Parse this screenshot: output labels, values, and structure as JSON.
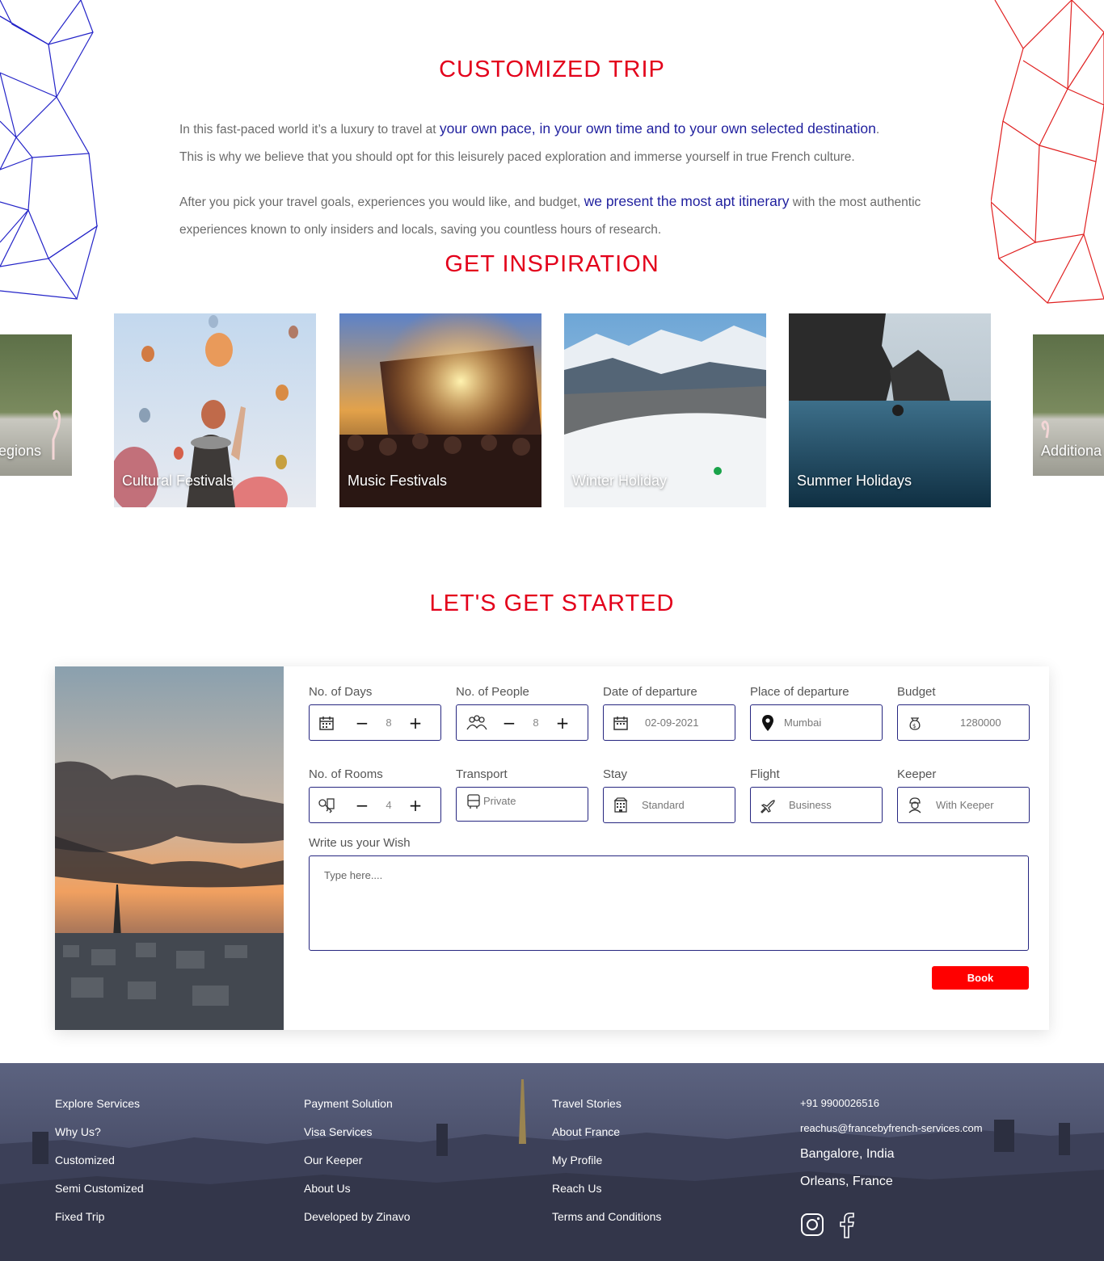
{
  "customized_trip": {
    "title": "CUSTOMIZED TRIP",
    "p1_a": "In this fast-paced world it’s a luxury to travel at ",
    "p1_hl": "your own pace, in your own time and to your own selected destination",
    "p1_b": ".",
    "p1_c": "This is why we believe that you should opt for this leisurely paced exploration and immerse yourself in true French culture.",
    "p2_a": "After you pick your travel goals, experiences you would like, and budget, ",
    "p2_hl": "we present the most apt itinerary",
    "p2_b": " with the most authentic experiences known to only insiders and locals, saving you countless hours of research."
  },
  "inspiration": {
    "title": "GET INSPIRATION",
    "cards": [
      {
        "label": "egions"
      },
      {
        "label": "Cultural Festivals"
      },
      {
        "label": "Music Festivals"
      },
      {
        "label": "Winter Holiday"
      },
      {
        "label": "Summer Holidays"
      },
      {
        "label": "Additiona"
      }
    ]
  },
  "get_started": {
    "title": "LET'S GET STARTED",
    "fields": {
      "days": {
        "label": "No. of Days",
        "value": "8",
        "icon": "calendar-icon"
      },
      "people": {
        "label": "No. of People",
        "value": "8",
        "icon": "people-icon"
      },
      "date": {
        "label": "Date of departure",
        "value": "02-09-2021",
        "icon": "calendar-icon"
      },
      "place": {
        "label": "Place of departure",
        "placeholder": "Mumbai",
        "icon": "location-pin-icon"
      },
      "budget": {
        "label": "Budget",
        "value": "1280000",
        "icon": "money-bag-icon"
      },
      "rooms": {
        "label": "No. of Rooms",
        "value": "4",
        "icon": "room-key-icon"
      },
      "transport": {
        "label": "Transport",
        "value": "Private",
        "icon": "bus-icon"
      },
      "stay": {
        "label": "Stay",
        "value": "Standard",
        "icon": "building-icon"
      },
      "flight": {
        "label": "Flight",
        "value": "Business",
        "icon": "plane-icon"
      },
      "keeper": {
        "label": "Keeper",
        "value": "With Keeper",
        "icon": "keeper-icon"
      }
    },
    "wish_label": "Write us your Wish",
    "wish_placeholder": "Type here....",
    "book_label": "Book",
    "minus": "−",
    "plus": "+"
  },
  "footer": {
    "col1": [
      "Explore Services",
      "Why Us?",
      "Customized",
      "Semi Customized",
      "Fixed Trip"
    ],
    "col2": [
      "Payment Solution",
      "Visa Services",
      "Our Keeper",
      "About Us",
      "Developed by Zinavo"
    ],
    "col3": [
      "Travel Stories",
      "About France",
      "My Profile",
      "Reach Us",
      "Terms and Conditions"
    ],
    "phone": "+91 9900026516",
    "email": "reachus@francebyfrench-services.com",
    "city1": "Bangalore, India",
    "city2": "Orleans, France",
    "social": [
      "instagram-icon",
      "facebook-icon"
    ]
  },
  "colors": {
    "accent_red": "#e3001b",
    "accent_blue": "#1f1f9e",
    "field_border": "#262680",
    "button_red": "#ff0000"
  }
}
